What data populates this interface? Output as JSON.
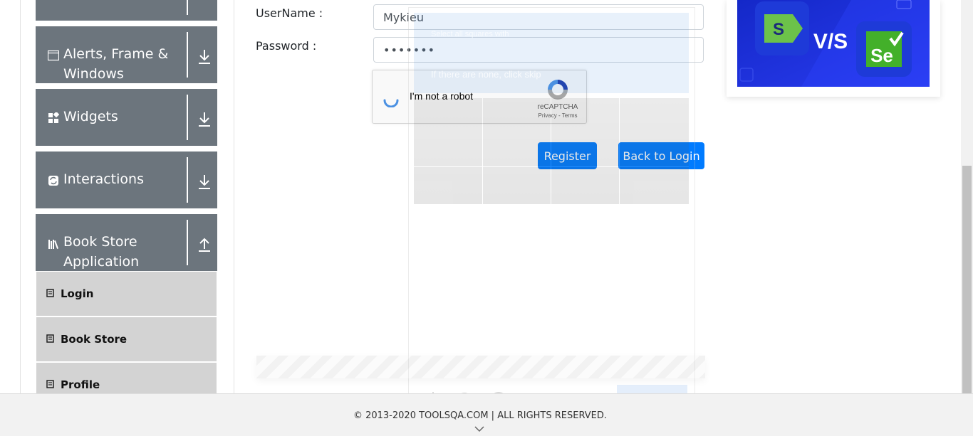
{
  "sidebar": {
    "groups": [
      {
        "label": "Alerts, Frame &",
        "label2": "Windows",
        "icon": "window-icon",
        "arrow": "download-arrow-icon"
      },
      {
        "label": "Widgets",
        "icon": "widgets-icon",
        "arrow": "download-arrow-icon"
      },
      {
        "label": "Interactions",
        "icon": "interactions-icon",
        "arrow": "download-arrow-icon"
      },
      {
        "label": "Book Store",
        "label2": "Application",
        "icon": "books-icon",
        "arrow": "upload-arrow-icon"
      }
    ],
    "book_store_items": [
      {
        "label": "Login",
        "icon": "book-icon"
      },
      {
        "label": "Book Store",
        "icon": "book-icon"
      },
      {
        "label": "Profile",
        "icon": "book-icon"
      }
    ]
  },
  "form": {
    "username_label": "UserName :",
    "username_value": "Mykieu",
    "password_label": "Password :",
    "password_value": "•••••••",
    "register_label": "Register",
    "back_label": "Back to Login"
  },
  "recaptcha": {
    "checkbox_label": "I'm not a robot",
    "brand": "reCAPTCHA",
    "links": "Privacy - Terms"
  },
  "challenge": {
    "instruction": "Select all squares with",
    "skip_hint": "If there are none, click skip"
  },
  "ad": {
    "left_logo": "S",
    "versus": "V/S",
    "right_logo": "Se"
  },
  "footer": {
    "copyright": "© 2013-2020 TOOLSQA.COM | ALL RIGHTS RESERVED."
  },
  "colors": {
    "sidebar_group_bg": "#6c757d",
    "sidebar_item_bg": "#d3d3d3",
    "button_primary": "#007bff",
    "ad_bg": "#1a2fd6",
    "ad_green": "#6cc24a"
  }
}
